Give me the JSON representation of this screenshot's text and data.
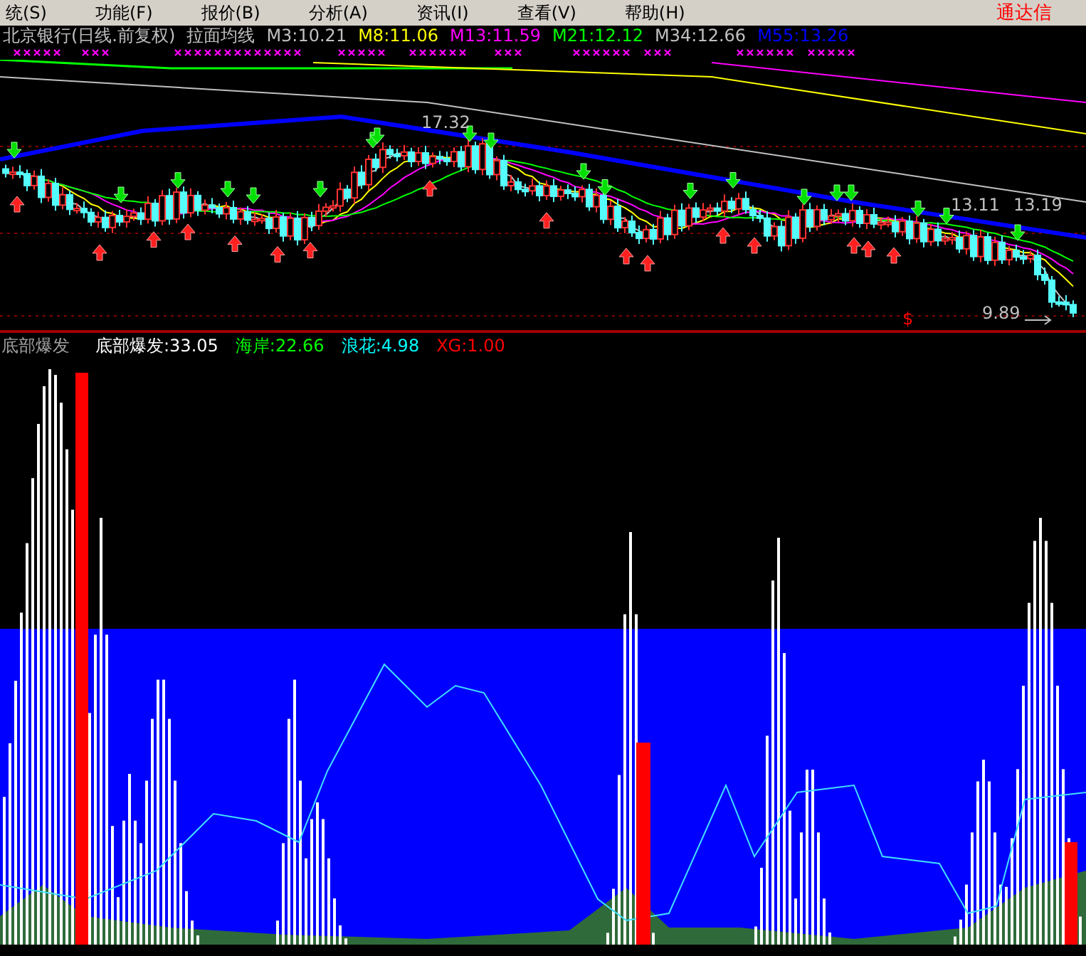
{
  "menu": {
    "items": [
      "统(S)",
      "功能(F)",
      "报价(B)",
      "分析(A)",
      "资讯(I)",
      "查看(V)",
      "帮助(H)"
    ],
    "brand": "通达信"
  },
  "header": {
    "title": "北京银行(日线.前复权)",
    "indicator": "拉面均线",
    "values": [
      {
        "text": "M3:10.21",
        "color": "#c0c0c0"
      },
      {
        "text": "M8:11.06",
        "color": "#ffff00"
      },
      {
        "text": "M13:11.59",
        "color": "#ff00ff"
      },
      {
        "text": "M21:12.12",
        "color": "#00ff00"
      },
      {
        "text": "M34:12.66",
        "color": "#c0c0c0"
      },
      {
        "text": "M55:13.26",
        "color": "#0000ff"
      }
    ]
  },
  "price_chart": {
    "labels": [
      {
        "kind": "high",
        "text": "17.32"
      },
      {
        "kind": "range_start",
        "text": "13.11"
      },
      {
        "kind": "range_end",
        "text": "13.19"
      },
      {
        "kind": "low",
        "text": "9.89"
      },
      {
        "kind": "signal",
        "text": "$"
      }
    ]
  },
  "indicator": {
    "name": "底部爆发",
    "values": [
      {
        "text": "底部爆发:33.05",
        "color": "#ffffff"
      },
      {
        "text": "海岸:22.66",
        "color": "#00ff00"
      },
      {
        "text": "浪花:4.98",
        "color": "#00ffff"
      },
      {
        "text": "XG:1.00",
        "color": "#ff0000"
      }
    ]
  }
}
